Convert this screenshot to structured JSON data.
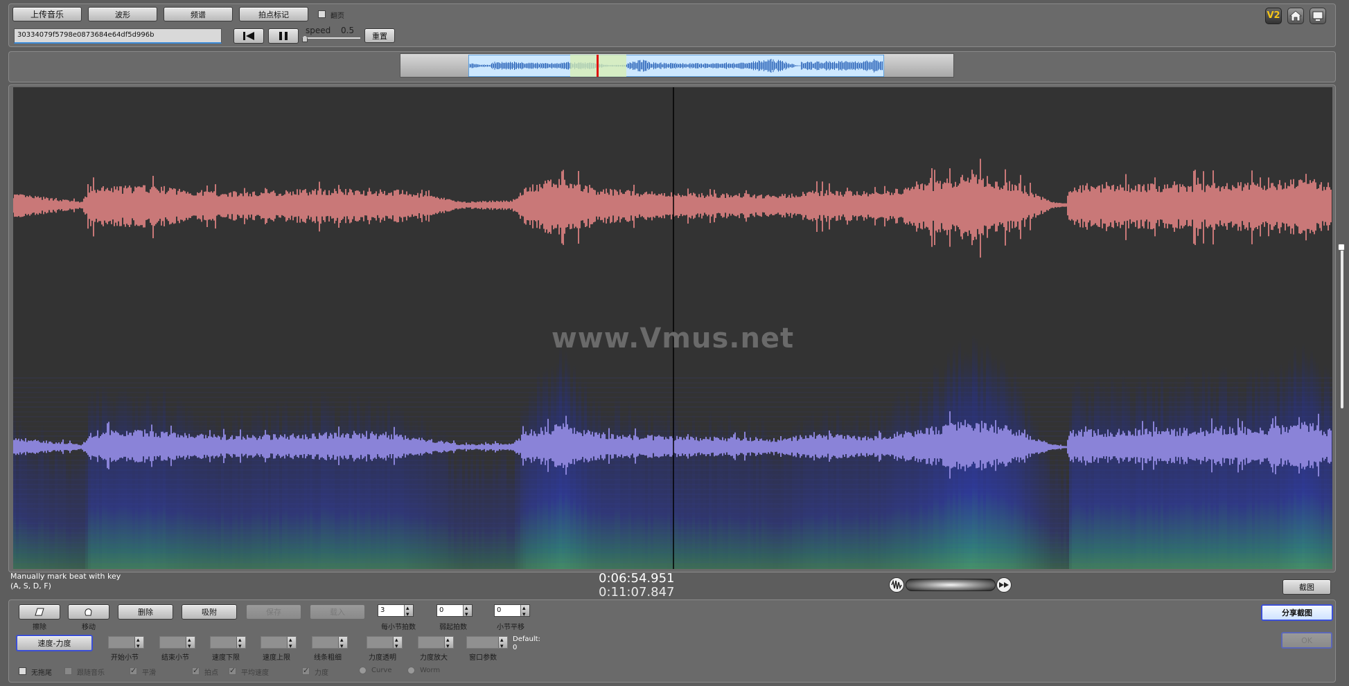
{
  "toolbar": {
    "upload_label": "上传音乐",
    "waveform_label": "波形",
    "spectrum_label": "频谱",
    "beat_mark_label": "拍点标记",
    "flip_label": "翻页",
    "file_id": "30334079f5798e0873684e64df5d996b",
    "speed_label": "speed",
    "speed_value": "0.5",
    "reset_label": "重置",
    "v2_badge": "V2"
  },
  "watermark": "www.Vmus.net",
  "status": {
    "hint_line1": "Manually mark beat with key",
    "hint_line2": "(A, S, D, F)",
    "current_time": "0:06:54.951",
    "total_time": "0:11:07.847",
    "screenshot_label": "截图"
  },
  "bottom": {
    "erase_label": "擦除",
    "move_label": "移动",
    "delete_label": "删除",
    "snap_label": "吸附",
    "save_label": "保存",
    "load_label": "载入",
    "beats_per_bar_value": "3",
    "beats_per_bar_label": "每小节拍数",
    "pickup_beats_value": "0",
    "pickup_beats_label": "弱起拍数",
    "bar_offset_value": "0",
    "bar_offset_label": "小节平移",
    "tempo_dynamics_label": "速度-力度",
    "start_bar_label": "开始小节",
    "end_bar_label": "结束小节",
    "tempo_low_label": "速度下限",
    "tempo_high_label": "速度上限",
    "line_width_label": "线条粗细",
    "dynamics_transparency_label": "力度透明",
    "dynamics_zoom_label": "力度放大",
    "window_param_label": "窗口参数",
    "default_label": "Default:",
    "default_value": "0",
    "share_screenshot_label": "分享截图",
    "ok_label": "OK",
    "checkboxes": {
      "no_smear": "无拖尾",
      "follow_music": "跟随音乐",
      "smooth": "平滑",
      "beat": "拍点",
      "avg_tempo": "平均速度",
      "dynamics": "力度"
    },
    "radios": {
      "curve": "Curve",
      "worm": "Worm"
    }
  },
  "colors": {
    "waveform_top": "#c97878",
    "waveform_bottom": "#8a83d8",
    "canvas_bg": "#333333",
    "spectrogram": "#2c3aa0",
    "overview_selection": "#cde8ff",
    "accent_blue": "#3b4fd6"
  },
  "icons": [
    "home-icon",
    "monitor-icon",
    "skip-back-icon",
    "pause-icon",
    "waveform-icon",
    "fast-forward-icon"
  ]
}
